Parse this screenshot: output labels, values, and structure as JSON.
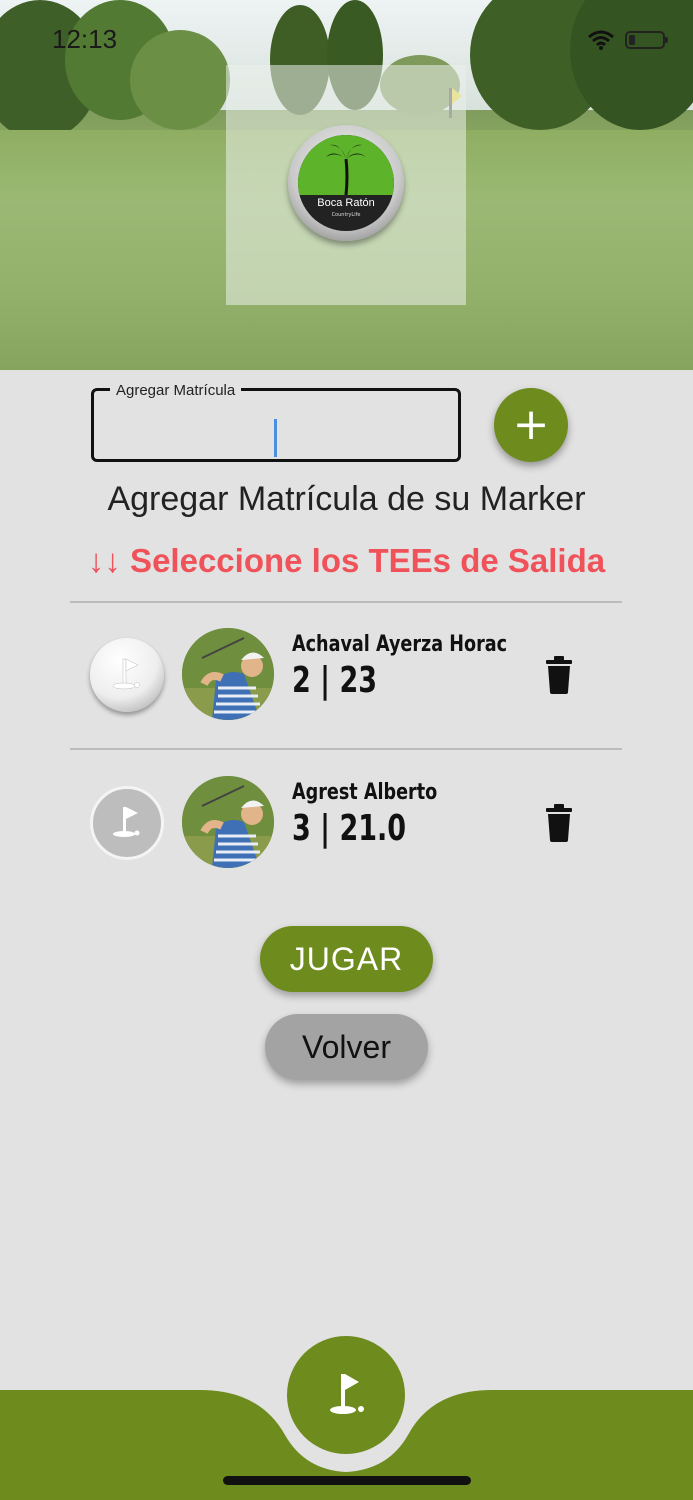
{
  "status_bar": {
    "time": "12:13"
  },
  "brand": {
    "logo_text": "Boca Ratón",
    "logo_subtext": "CountryLife"
  },
  "matricula": {
    "label": "Agregar Matrícula",
    "value": ""
  },
  "add_button": {
    "label": "+"
  },
  "subtitle": "Agregar Matrícula de su Marker",
  "tee_hint": "↓↓ Seleccione los TEEs de Salida",
  "players": [
    {
      "name": "Achaval Ayerza Horac",
      "score": "2 | 23",
      "tee": "white"
    },
    {
      "name": "Agrest Alberto",
      "score": "3 | 21.0",
      "tee": "grey"
    }
  ],
  "buttons": {
    "play": "JUGAR",
    "back": "Volver"
  },
  "colors": {
    "accent": "#6e8b1e",
    "hint": "#f0525a",
    "background": "#e2e2e2"
  }
}
